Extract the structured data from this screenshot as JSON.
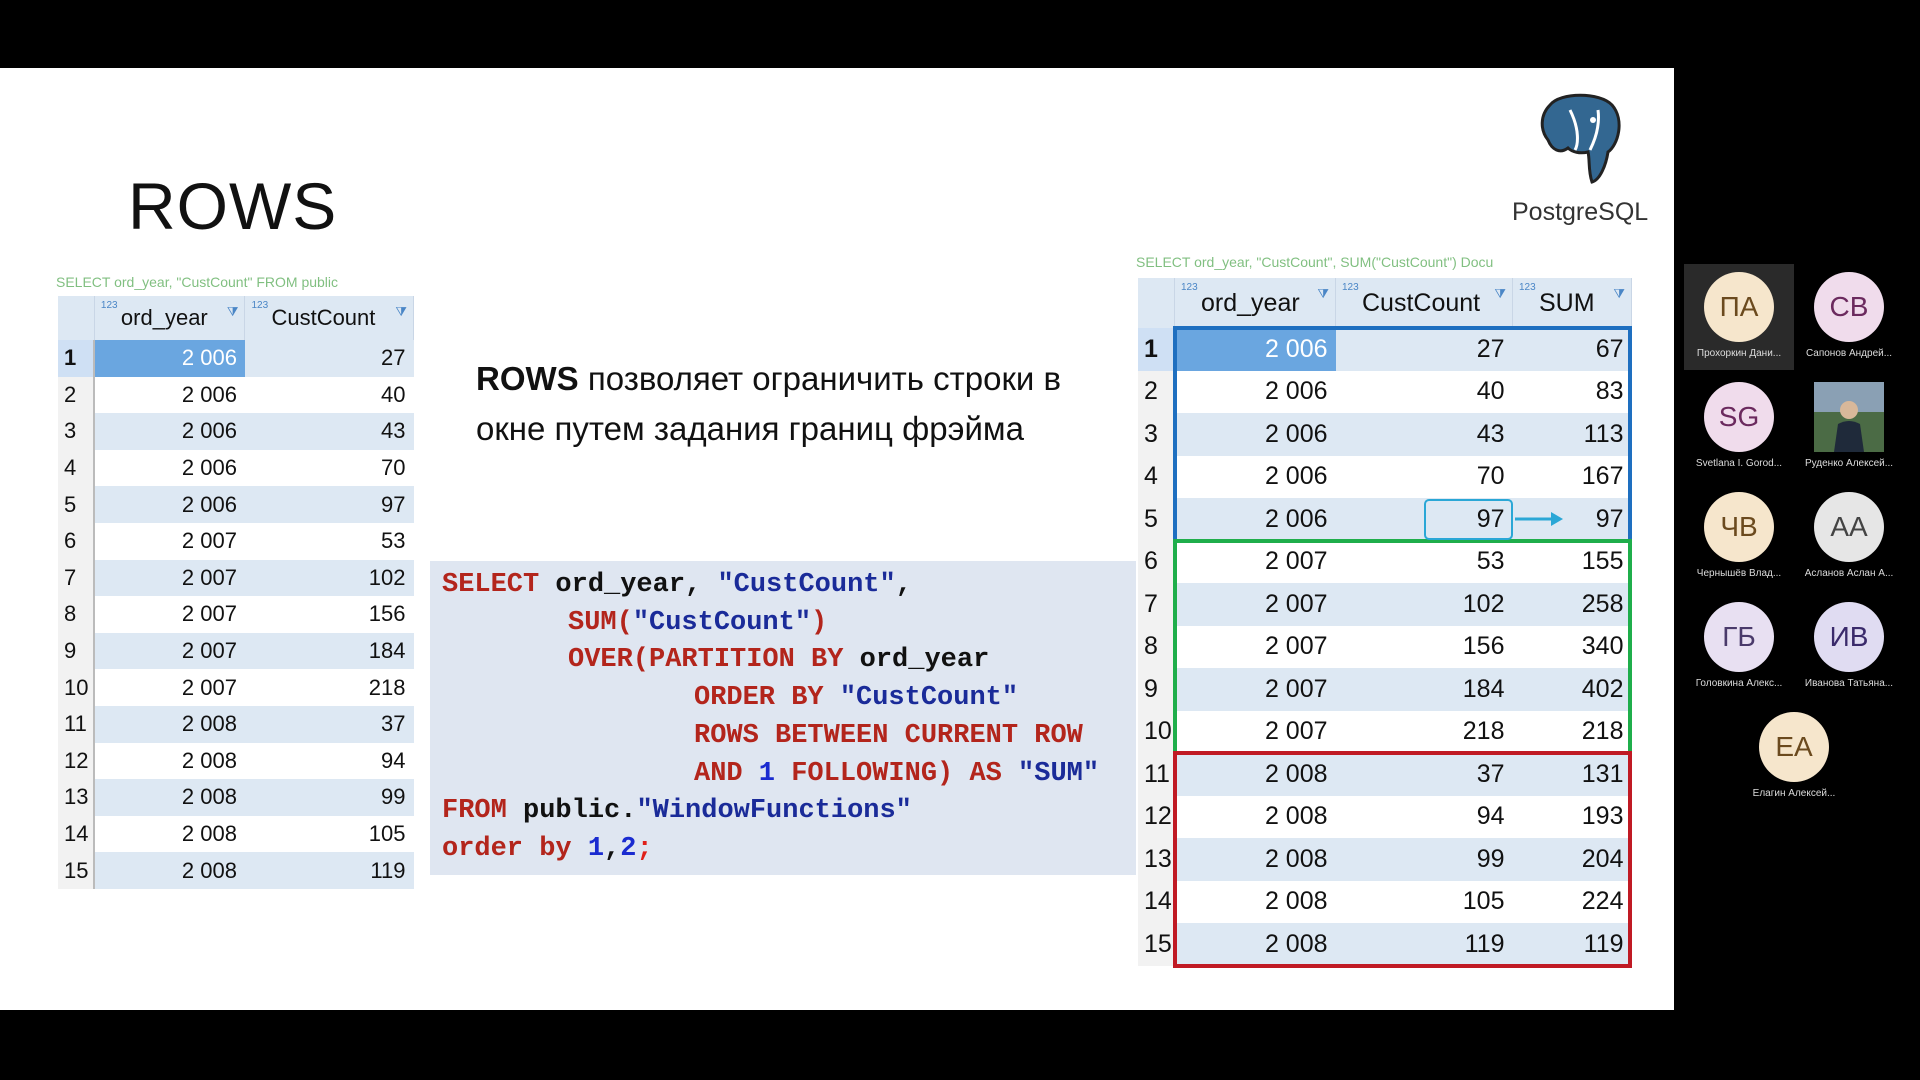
{
  "slide": {
    "title": "ROWS",
    "logo_text": "PostgreSQL",
    "faint_left": "SELECT ord_year, \"CustCount\" FROM public",
    "faint_right": "SELECT ord_year, \"CustCount\", SUM(\"CustCount\")   Docu",
    "description_bold": "ROWS",
    "description_rest": " позволяет ограничить строки в окне путем задания границ фрэйма",
    "code_lines": [
      [
        "SELECT",
        " ord_year, ",
        "\"CustCount\"",
        ","
      ],
      [
        "SUM(",
        "\"CustCount\"",
        ")"
      ],
      [
        "OVER(PARTITION BY",
        " ord_year"
      ],
      [
        "ORDER BY",
        " \"CustCount\""
      ],
      [
        "ROWS BETWEEN CURRENT ROW"
      ],
      [
        "AND",
        " 1",
        " FOLLOWING)",
        " AS",
        " \"SUM\""
      ],
      [
        "FROM",
        " public.",
        "\"WindowFunctions\""
      ],
      [
        "order by",
        " 1",
        ",",
        "2",
        ";"
      ]
    ]
  },
  "left_table": {
    "columns": [
      "ord_year",
      "CustCount"
    ],
    "type_badge": "123",
    "rows": [
      [
        "1",
        "2 006",
        "27"
      ],
      [
        "2",
        "2 006",
        "40"
      ],
      [
        "3",
        "2 006",
        "43"
      ],
      [
        "4",
        "2 006",
        "70"
      ],
      [
        "5",
        "2 006",
        "97"
      ],
      [
        "6",
        "2 007",
        "53"
      ],
      [
        "7",
        "2 007",
        "102"
      ],
      [
        "8",
        "2 007",
        "156"
      ],
      [
        "9",
        "2 007",
        "184"
      ],
      [
        "10",
        "2 007",
        "218"
      ],
      [
        "11",
        "2 008",
        "37"
      ],
      [
        "12",
        "2 008",
        "94"
      ],
      [
        "13",
        "2 008",
        "99"
      ],
      [
        "14",
        "2 008",
        "105"
      ],
      [
        "15",
        "2 008",
        "119"
      ]
    ]
  },
  "right_table": {
    "columns": [
      "ord_year",
      "CustCount",
      "SUM"
    ],
    "type_badge": "123",
    "rows": [
      [
        "1",
        "2 006",
        "27",
        "67"
      ],
      [
        "2",
        "2 006",
        "40",
        "83"
      ],
      [
        "3",
        "2 006",
        "43",
        "113"
      ],
      [
        "4",
        "2 006",
        "70",
        "167"
      ],
      [
        "5",
        "2 006",
        "97",
        "97"
      ],
      [
        "6",
        "2 007",
        "53",
        "155"
      ],
      [
        "7",
        "2 007",
        "102",
        "258"
      ],
      [
        "8",
        "2 007",
        "156",
        "340"
      ],
      [
        "9",
        "2 007",
        "184",
        "402"
      ],
      [
        "10",
        "2 007",
        "218",
        "218"
      ],
      [
        "11",
        "2 008",
        "37",
        "131"
      ],
      [
        "12",
        "2 008",
        "94",
        "193"
      ],
      [
        "13",
        "2 008",
        "99",
        "204"
      ],
      [
        "14",
        "2 008",
        "105",
        "224"
      ],
      [
        "15",
        "2 008",
        "119",
        "119"
      ]
    ],
    "partition_colors": [
      "#1e6fc0",
      "#1fae4b",
      "#c01a24"
    ]
  },
  "participants": [
    {
      "initials": "ПА",
      "name": "Прохоркин Дани...",
      "bg": "#f6e6cc",
      "fg": "#6b4a1e"
    },
    {
      "initials": "СВ",
      "name": "Сапонов Андрей...",
      "bg": "#f0dcec",
      "fg": "#6b2a5e"
    },
    {
      "initials": "SG",
      "name": "Svetlana I. Gorod...",
      "bg": "#f0dcec",
      "fg": "#6b2a5e"
    },
    {
      "initials": "",
      "name": "Руденко Алексей...",
      "bg": "#3a5a3a",
      "fg": "#fff"
    },
    {
      "initials": "ЧВ",
      "name": "Чернышёв Влад...",
      "bg": "#f6e6cc",
      "fg": "#6b4a1e"
    },
    {
      "initials": "АА",
      "name": "Асланов Аслан А...",
      "bg": "#e6e6e6",
      "fg": "#444"
    },
    {
      "initials": "ГБ",
      "name": "Головкина Алекс...",
      "bg": "#e8e0f2",
      "fg": "#4a3a6b"
    },
    {
      "initials": "ИВ",
      "name": "Иванова Татьяна...",
      "bg": "#e0dcf2",
      "fg": "#3a2a6b"
    },
    {
      "initials": "ЕА",
      "name": "Елагин Алексей...",
      "bg": "#f6e6cc",
      "fg": "#6b4a1e"
    }
  ],
  "toolbar_icons": [
    "prev-icon",
    "next-icon",
    "pen-icon",
    "slides-icon",
    "zoom-icon",
    "more-icon"
  ]
}
